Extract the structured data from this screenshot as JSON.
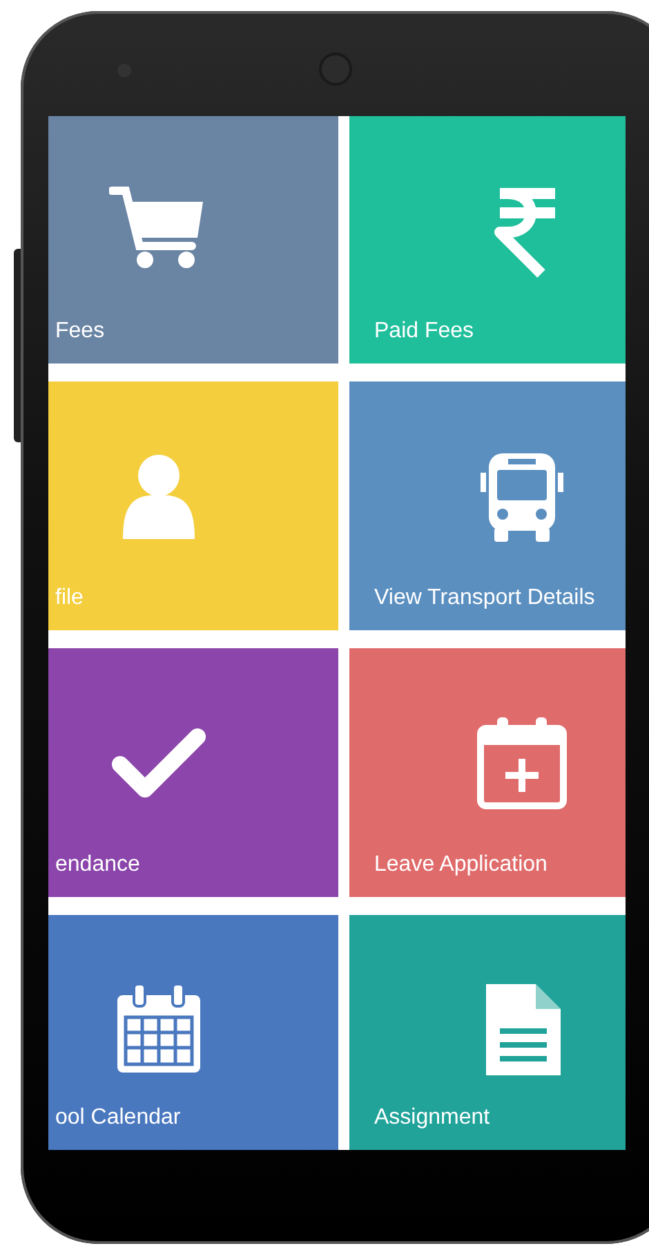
{
  "tiles": [
    {
      "label": "Fees",
      "kind": "cart",
      "color": "#6a84a3"
    },
    {
      "label": "Paid Fees",
      "kind": "rupee",
      "color": "#1fbf9b"
    },
    {
      "label": "file",
      "kind": "person",
      "color": "#f4ce3c"
    },
    {
      "label": "View Transport Details",
      "kind": "bus",
      "color": "#5b8fc0"
    },
    {
      "label": "endance",
      "kind": "check",
      "color": "#8b45ab"
    },
    {
      "label": "Leave Application",
      "kind": "calendar-plus",
      "color": "#e06b6b"
    },
    {
      "label": "ool Calendar",
      "kind": "calendar",
      "color": "#4a78bf"
    },
    {
      "label": "Assignment",
      "kind": "document",
      "color": "#21a39a"
    }
  ]
}
